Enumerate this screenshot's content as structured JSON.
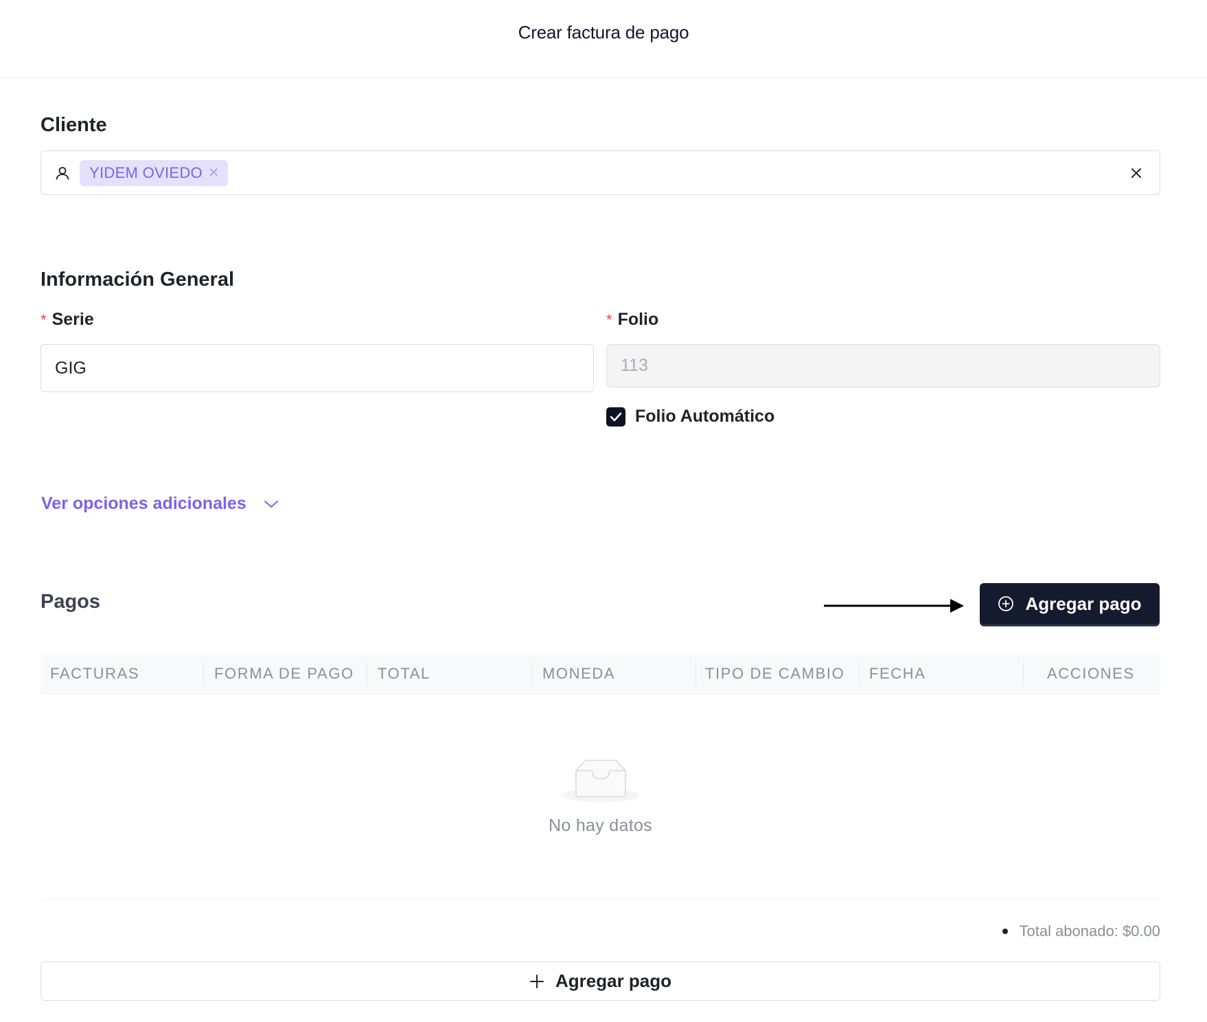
{
  "header": {
    "title": "Crear factura de pago"
  },
  "client": {
    "section_title": "Cliente",
    "selected_tag": "YIDEM OVIEDO",
    "tag_remove_glyph": "✕"
  },
  "general": {
    "section_title": "Información General",
    "serie_label": "Serie",
    "serie_value": "GIG",
    "folio_label": "Folio",
    "folio_value": "113",
    "auto_folio_label": "Folio Automático",
    "auto_folio_checked": true,
    "required_mark": "*"
  },
  "more_options": {
    "label": "Ver opciones adicionales"
  },
  "payments": {
    "section_title": "Pagos",
    "add_button_label": "Agregar pago",
    "columns": [
      "FACTURAS",
      "FORMA DE PAGO",
      "TOTAL",
      "MONEDA",
      "TIPO DE CAMBIO",
      "FECHA",
      "ACCIONES"
    ],
    "empty_text": "No hay datos",
    "total_text": "Total abonado: $0.00",
    "footer_add_label": "Agregar pago"
  },
  "colors": {
    "accent": "#7c63e6",
    "primary_button": "#151b2e",
    "required": "#e5484d"
  },
  "icons": {
    "user": "user-icon",
    "clear": "close-icon",
    "chevron": "chevron-down-icon",
    "add_circle": "plus-circle-icon",
    "plus": "plus-icon",
    "empty": "empty-inbox-icon",
    "arrow": "arrow-right-icon"
  }
}
